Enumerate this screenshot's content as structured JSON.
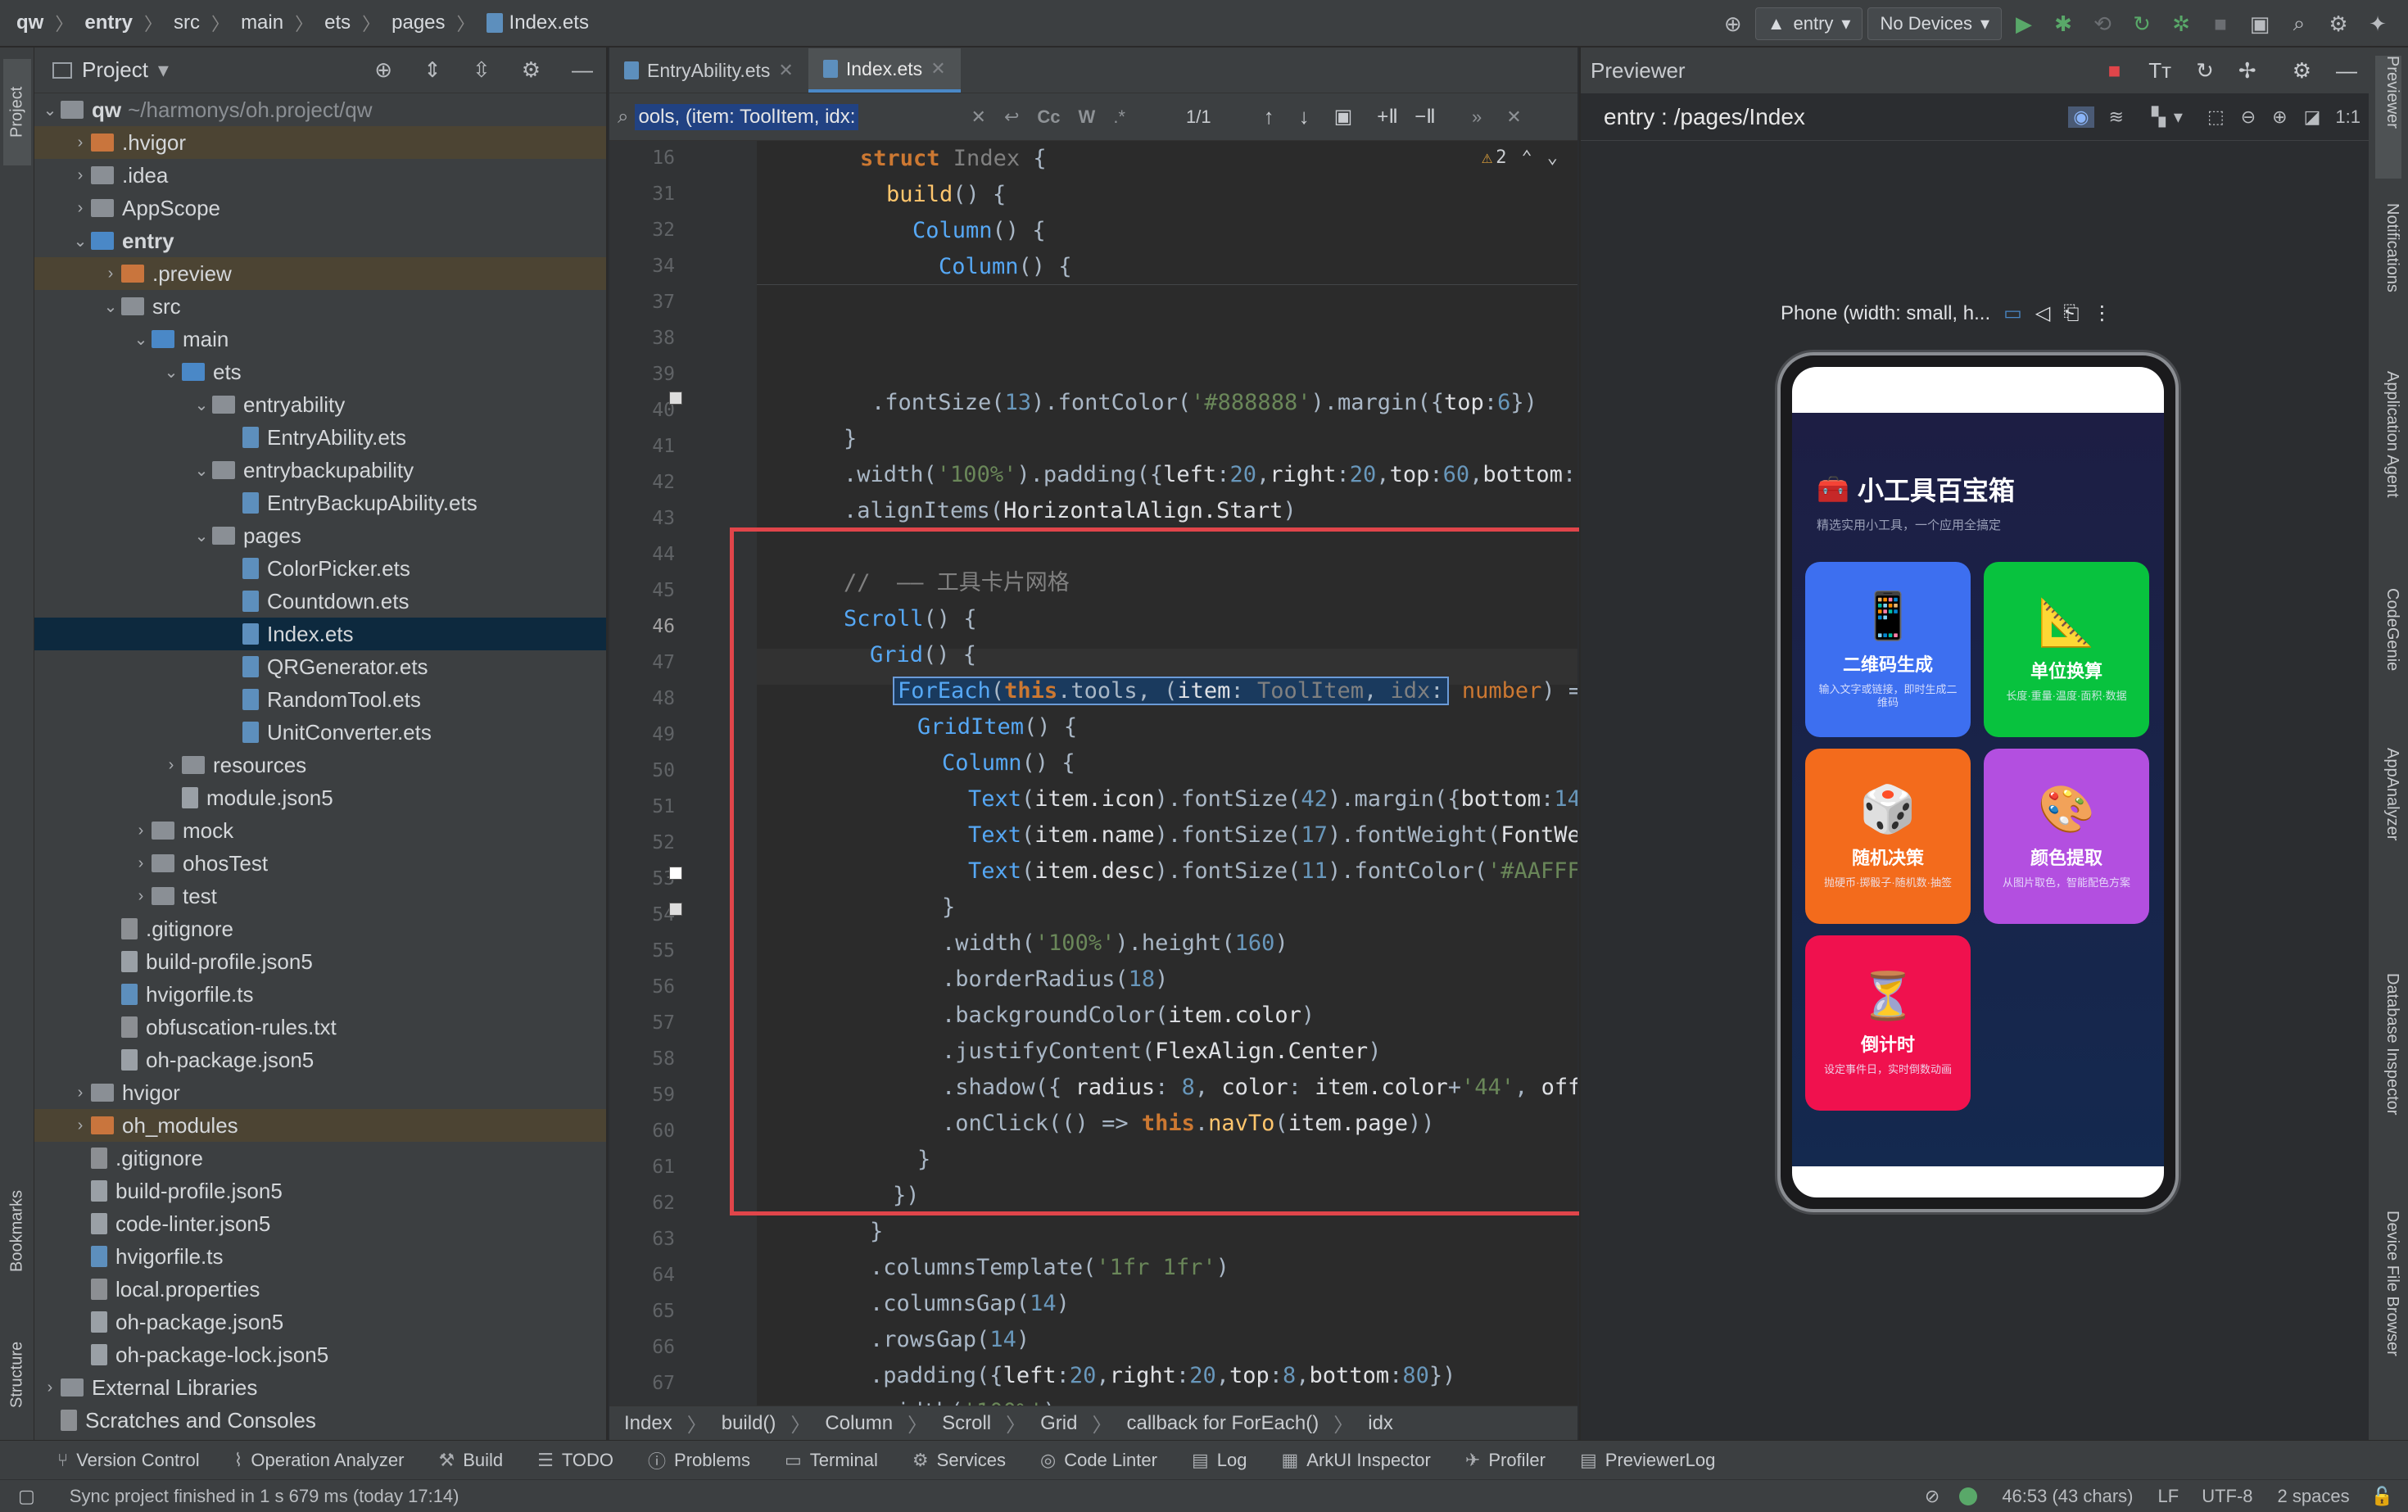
{
  "breadcrumb": [
    "qw",
    "entry",
    "src",
    "main",
    "ets",
    "pages",
    "Index.ets"
  ],
  "toolbar": {
    "run_config": "entry",
    "device": "No Devices"
  },
  "left_stripe": {
    "project": "Project",
    "bookmarks": "Bookmarks",
    "structure": "Structure"
  },
  "project": {
    "title": "Project",
    "tree": [
      {
        "label": "qw",
        "extra": "~/harmonys/oh.project/qw",
        "bold": true
      },
      {
        "label": ".hvigor"
      },
      {
        "label": ".idea"
      },
      {
        "label": "AppScope"
      },
      {
        "label": "entry",
        "bold": true
      },
      {
        "label": ".preview"
      },
      {
        "label": "src"
      },
      {
        "label": "main"
      },
      {
        "label": "ets"
      },
      {
        "label": "entryability"
      },
      {
        "label": "EntryAbility.ets"
      },
      {
        "label": "entrybackupability"
      },
      {
        "label": "EntryBackupAbility.ets"
      },
      {
        "label": "pages"
      },
      {
        "label": "ColorPicker.ets"
      },
      {
        "label": "Countdown.ets"
      },
      {
        "label": "Index.ets"
      },
      {
        "label": "QRGenerator.ets"
      },
      {
        "label": "RandomTool.ets"
      },
      {
        "label": "UnitConverter.ets"
      },
      {
        "label": "resources"
      },
      {
        "label": "module.json5"
      },
      {
        "label": "mock"
      },
      {
        "label": "ohosTest"
      },
      {
        "label": "test"
      },
      {
        "label": ".gitignore"
      },
      {
        "label": "build-profile.json5"
      },
      {
        "label": "hvigorfile.ts"
      },
      {
        "label": "obfuscation-rules.txt"
      },
      {
        "label": "oh-package.json5"
      },
      {
        "label": "hvigor"
      },
      {
        "label": "oh_modules"
      },
      {
        "label": ".gitignore"
      },
      {
        "label": "build-profile.json5"
      },
      {
        "label": "code-linter.json5"
      },
      {
        "label": "hvigorfile.ts"
      },
      {
        "label": "local.properties"
      },
      {
        "label": "oh-package.json5"
      },
      {
        "label": "oh-package-lock.json5"
      },
      {
        "label": "External Libraries"
      },
      {
        "label": "Scratches and Consoles"
      }
    ]
  },
  "editor": {
    "tabs": [
      "EntryAbility.ets",
      "Index.ets"
    ],
    "find": {
      "value": "ools, (item: ToolItem, idx:",
      "count": "1/1",
      "cc": "Cc",
      "w": "W",
      "regex": ".*"
    },
    "warnings": "2",
    "line_numbers": [
      "16",
      "31",
      "32",
      "34",
      "37",
      "38",
      "39",
      "40",
      "41",
      "42",
      "43",
      "44",
      "45",
      "46",
      "47",
      "48",
      "49",
      "50",
      "51",
      "52",
      "53",
      "54",
      "55",
      "56",
      "57",
      "58",
      "59",
      "60",
      "61",
      "62",
      "63",
      "64",
      "65",
      "66",
      "67"
    ],
    "code_breadcrumb": [
      "Index",
      "build()",
      "Column",
      "Scroll",
      "Grid",
      "callback for ForEach()",
      "idx"
    ]
  },
  "previewer": {
    "title": "Previewer",
    "route": "entry : /pages/Index",
    "device_label": "Phone (width: small, h...",
    "app": {
      "title": "小工具百宝箱",
      "title_icon": "🧰",
      "subtitle": "精选实用小工具，一个应用全搞定",
      "cards": [
        {
          "icon": "📱",
          "name": "二维码生成",
          "desc": "输入文字或链接，即时生成二维码",
          "color": "#3d6ff0"
        },
        {
          "icon": "📐",
          "name": "单位换算",
          "desc": "长度·重量·温度·面积·数据",
          "color": "#08c23e"
        },
        {
          "icon": "🎲",
          "name": "随机决策",
          "desc": "抛硬币·掷骰子·随机数·抽签",
          "color": "#f36b1c"
        },
        {
          "icon": "🎨",
          "name": "颜色提取",
          "desc": "从图片取色，智能配色方案",
          "color": "#b34fe0"
        },
        {
          "icon": "⏳",
          "name": "倒计时",
          "desc": "设定事件日，实时倒数动画",
          "color": "#f0114e"
        }
      ]
    }
  },
  "right_stripe": [
    "Previewer",
    "Notifications",
    "Application Agent",
    "CodeGenie",
    "AppAnalyzer",
    "Database Inspector",
    "Device File Browser"
  ],
  "tool_windows": [
    "Version Control",
    "Operation Analyzer",
    "Build",
    "TODO",
    "Problems",
    "Terminal",
    "Services",
    "Code Linter",
    "Log",
    "ArkUI Inspector",
    "Profiler",
    "PreviewerLog"
  ],
  "status": {
    "message": "Sync project finished in 1 s 679 ms (today 17:14)",
    "position": "46:53 (43 chars)",
    "line_sep": "LF",
    "encoding": "UTF-8",
    "indent": "2 spaces"
  }
}
